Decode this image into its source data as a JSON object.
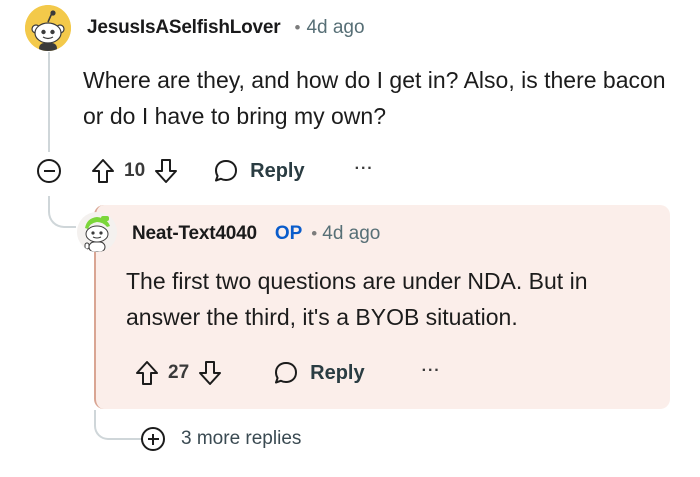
{
  "comment": {
    "username": "JesusIsASelfishLover",
    "separator": "•",
    "time": "4d ago",
    "body": "Where are they, and how do I get in? Also, is there bacon or do I have to bring my own?",
    "votes": "10",
    "reply_label": "Reply",
    "more_label": "···",
    "avatar_color": "#f3c94a"
  },
  "reply": {
    "username": "Neat-Text4040",
    "badge": "OP",
    "separator": "•",
    "time": "4d ago",
    "body": "The first two questions are under NDA. But in answer the third, it's a BYOB situation.",
    "votes": "27",
    "reply_label": "Reply",
    "more_label": "···",
    "card_color": "#fbeeea",
    "badge_color": "#0a5ccb"
  },
  "more_replies": {
    "label": "3 more replies"
  },
  "icons": {
    "upvote": "arrow-up-icon",
    "downvote": "arrow-down-icon",
    "reply": "speech-bubble-icon",
    "collapse": "minus-circle-icon",
    "expand": "plus-circle-icon"
  }
}
